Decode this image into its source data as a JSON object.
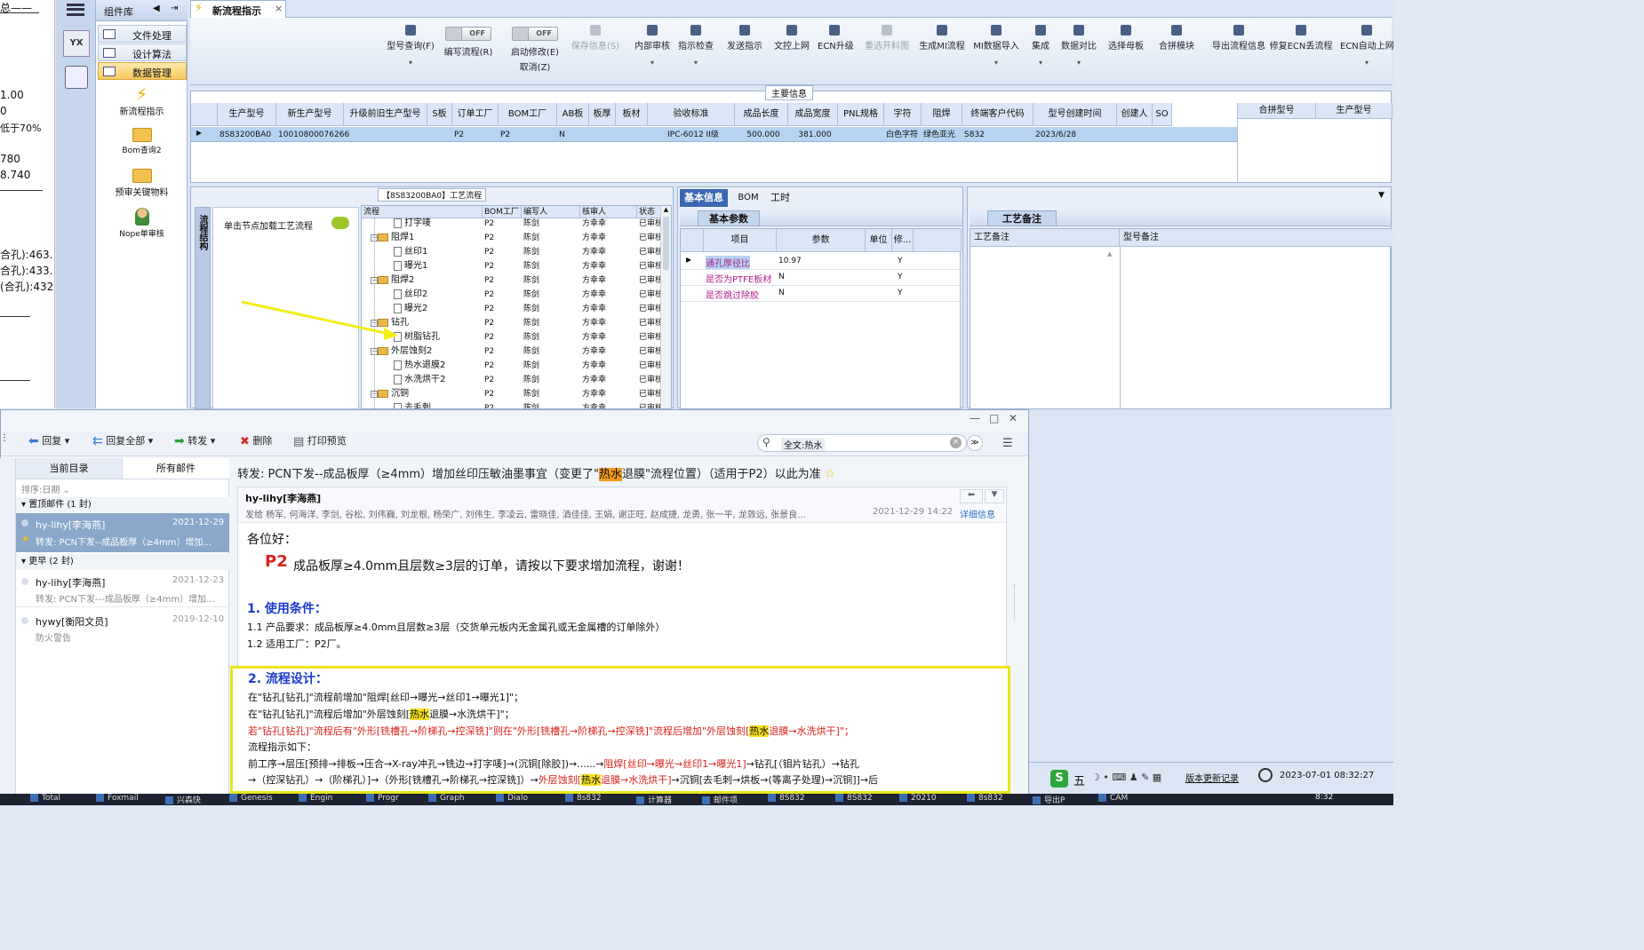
{
  "left_doc": {
    "lines": [
      "总——",
      "1.00",
      "0",
      "低于70%",
      "780",
      "8.740",
      "合孔):463.",
      "合孔):433.",
      "(合孔):432"
    ]
  },
  "nav": {
    "header": "组件库",
    "groups": [
      "文件处理",
      "设计算法",
      "数据管理"
    ],
    "tools": [
      {
        "label": "新流程指示",
        "icon": "lightning-icon"
      },
      {
        "label": "Bom查询2",
        "icon": "folder-icon"
      },
      {
        "label": "预审关键物料",
        "icon": "folder-icon"
      },
      {
        "label": "Nope单审核",
        "icon": "user-icon"
      }
    ]
  },
  "tab": {
    "title": "新流程指示",
    "close": "×"
  },
  "toolbar": {
    "buttons": [
      {
        "label": "型号查询(F)",
        "dd": "▾",
        "dis": false
      },
      {
        "label": "编写流程(R)",
        "toggle": "OFF",
        "dis": false
      },
      {
        "label": "启动修改(E)",
        "toggle": "OFF",
        "sub": "取消(Z)",
        "dis": false
      },
      {
        "label": "保存信息(S)",
        "dis": true
      },
      {
        "label": "内部审核",
        "dd": "▾",
        "dis": false
      },
      {
        "label": "指示检查",
        "dd": "▾",
        "dis": false
      },
      {
        "label": "发送指示",
        "dis": false
      },
      {
        "label": "文控上网",
        "dis": false
      },
      {
        "label": "ECN升级",
        "dis": false
      },
      {
        "label": "重选开料图",
        "dis": true
      },
      {
        "label": "生成MI流程",
        "dis": false
      },
      {
        "label": "MI数据导入",
        "dd": "▾",
        "dis": false
      },
      {
        "label": "集成",
        "dd": "▾",
        "dis": false
      },
      {
        "label": "数据对比",
        "dd": "▾",
        "dis": false
      },
      {
        "label": "选择母板",
        "dis": false
      },
      {
        "label": "合拼模块",
        "dis": false
      },
      {
        "label": "导出流程信息",
        "dis": false
      },
      {
        "label": "修复ECN丢流程",
        "dis": false
      },
      {
        "label": "ECN自动上网",
        "dd": "▾",
        "dis": false
      }
    ]
  },
  "main_info": {
    "title": "主要信息",
    "headers": [
      "生产型号",
      "新生产型号",
      "升级前旧生产型号",
      "S板",
      "订单工厂",
      "BOM工厂",
      "AB板",
      "板厚",
      "板材",
      "验收标准",
      "成品长度",
      "成品宽度",
      "PNL规格",
      "字符",
      "阻焊",
      "终端客户代码",
      "型号创建时间",
      "创建人",
      "SO"
    ],
    "row": [
      "8S83200BA0",
      "10010800076266",
      "",
      "",
      "P2",
      "P2",
      "N",
      "",
      "",
      "IPC-6012 II级",
      "500.000",
      "381.000",
      "",
      "白色字符",
      "绿色亚光",
      "S832",
      "2023/6/28",
      "",
      ""
    ],
    "side_headers": [
      "合拼型号",
      "生产型号"
    ]
  },
  "flow": {
    "title": "【8S83200BA0】工艺流程",
    "side_tab": "流程结构",
    "hint": "单击节点加载工艺流程",
    "headers": [
      "流程",
      "BOM工厂",
      "编写人",
      "核审人",
      "状态"
    ],
    "rows": [
      {
        "name": "打字唛",
        "lvl": 1,
        "type": "doc",
        "bom": "P2",
        "w": "陈剑",
        "r": "方幸幸",
        "s": "已审核"
      },
      {
        "name": "阻焊1",
        "lvl": 0,
        "type": "folder",
        "bom": "P2",
        "w": "陈剑",
        "r": "方幸幸",
        "s": "已审核"
      },
      {
        "name": "丝印1",
        "lvl": 1,
        "type": "doc",
        "bom": "P2",
        "w": "陈剑",
        "r": "方幸幸",
        "s": "已审核"
      },
      {
        "name": "曝光1",
        "lvl": 1,
        "type": "doc",
        "bom": "P2",
        "w": "陈剑",
        "r": "方幸幸",
        "s": "已审核"
      },
      {
        "name": "阻焊2",
        "lvl": 0,
        "type": "folder",
        "bom": "P2",
        "w": "陈剑",
        "r": "方幸幸",
        "s": "已审核"
      },
      {
        "name": "丝印2",
        "lvl": 1,
        "type": "doc",
        "bom": "P2",
        "w": "陈剑",
        "r": "方幸幸",
        "s": "已审核"
      },
      {
        "name": "曝光2",
        "lvl": 1,
        "type": "doc",
        "bom": "P2",
        "w": "陈剑",
        "r": "方幸幸",
        "s": "已审核"
      },
      {
        "name": "钻孔",
        "lvl": 0,
        "type": "folder",
        "bom": "P2",
        "w": "陈剑",
        "r": "方幸幸",
        "s": "已审核"
      },
      {
        "name": "树脂钻孔",
        "lvl": 1,
        "type": "doc",
        "bom": "P2",
        "w": "陈剑",
        "r": "方幸幸",
        "s": "已审核"
      },
      {
        "name": "外层蚀刻2",
        "lvl": 0,
        "type": "folder",
        "bom": "P2",
        "w": "陈剑",
        "r": "方幸幸",
        "s": "已审核"
      },
      {
        "name": "热水退膜2",
        "lvl": 1,
        "type": "doc",
        "bom": "P2",
        "w": "陈剑",
        "r": "方幸幸",
        "s": "已审核"
      },
      {
        "name": "水洗烘干2",
        "lvl": 1,
        "type": "doc",
        "bom": "P2",
        "w": "陈剑",
        "r": "方幸幸",
        "s": "已审核"
      },
      {
        "name": "沉铜",
        "lvl": 0,
        "type": "folder",
        "bom": "P2",
        "w": "陈剑",
        "r": "方幸幸",
        "s": "已审核"
      },
      {
        "name": "去毛刺",
        "lvl": 1,
        "type": "doc",
        "bom": "P2",
        "w": "陈剑",
        "r": "方幸幸",
        "s": "已审核"
      }
    ]
  },
  "basic": {
    "tabs": [
      "基本信息",
      "BOM",
      "工时"
    ],
    "section": "基本参数",
    "headers": [
      "项目",
      "参数",
      "单位",
      "修..."
    ],
    "rows": [
      {
        "item": "通孔厚径比",
        "val": "10.97",
        "unit": "",
        "mod": "Y"
      },
      {
        "item": "是否为PTFE板材",
        "val": "N",
        "unit": "",
        "mod": "Y"
      },
      {
        "item": "是否跳过除胶",
        "val": "N",
        "unit": "",
        "mod": "Y"
      }
    ]
  },
  "remarks": {
    "tab": "工艺备注",
    "col1": "工艺备注",
    "col2": "型号备注"
  },
  "mail": {
    "toolbar": [
      "回复",
      "回复全部",
      "转发",
      "删除",
      "打印预览"
    ],
    "search": "全文:热水",
    "folder_tabs": [
      "当前目录",
      "所有邮件"
    ],
    "sort": "排序:日期",
    "groups": [
      {
        "title": "置顶邮件 (1 封)",
        "items": [
          {
            "from": "hy-lihy[李海燕]",
            "date": "2021-12-29",
            "subject": "转发: PCN下发--成品板厚（≥4mm）增加...",
            "sel": true
          }
        ]
      },
      {
        "title": "更早 (2 封)",
        "items": [
          {
            "from": "hy-lihy[李海燕]",
            "date": "2021-12-23",
            "subject": "转发: PCN下发---成品板厚（≥4mm）增加...",
            "sel": false
          },
          {
            "from": "hywy[衡阳文员]",
            "date": "2019-12-10",
            "subject": "防火警告",
            "sel": false
          }
        ]
      }
    ],
    "subject_pre": "转发: PCN下发--成品板厚（≥4mm）增加丝印压敏油墨事宜（变更了\"",
    "subject_hl": "热水",
    "subject_post": "退膜\"流程位置）（适用于P2）以此为准",
    "sender": "hy-lihy[李海燕]",
    "recipients": "发给 杨军, 何海洋, 李剑, 谷松, 刘伟巍, 刘龙根, 杨荣广, 刘伟生, 李凌云, 雷晓佳, 酒佳佳, 王娟, 谢正旺, 赵成捷, 龙勇, 张一平, 龙敦远, 张景良...",
    "sent": "2021-12-29 14:22",
    "details": "详细信息",
    "greeting": "各位好：",
    "p2": "P2",
    "intro": "成品板厚≥4.0mm且层数≥3层的订单，请按以下要求增加流程，谢谢！",
    "s1": "1. 使用条件：",
    "s1a": "1.1  产品要求：成品板厚≥4.0mm且层数≥3层（交货单元板内无金属孔或无金属槽的订单除外）",
    "s1b": "1.2  适用工厂：P2厂。",
    "s2": "2. 流程设计：",
    "l1": "在\"钻孔[钻孔]\"流程前增加\"阻焊[丝印→曝光→丝印1→曝光1]\"；",
    "l2a": "在\"钻孔[钻孔]\"流程后增加\"外层蚀刻[",
    "l2hl": "热水",
    "l2b": "退膜→水洗烘干]\"；",
    "l3a": "若\"钻孔[钻孔]\"流程后有\"外形[铣槽孔→阶梯孔→控深铣]\"则在\"外形[铣槽孔→阶梯孔→控深铣]\"流程后增加\"外层蚀刻[",
    "l3hl": "热水",
    "l3b": "退膜→水洗烘干]\"；",
    "l4": "流程指示如下：",
    "l5a": "前工序→层压[预排→排板→压合→X-ray冲孔→铣边→打字唛]→(沉铜[除胶])→......→",
    "l5r": "阻焊[丝印→曝光→丝印1→曝光1]",
    "l5b": "→钻孔[（钼片钻孔）→钻孔",
    "l6a": "→（控深钻孔）→（阶梯孔）]→（外形[铣槽孔→阶梯孔→控深铣]）→",
    "l6r": "外层蚀刻[",
    "l6hl": "热水",
    "l6r2": "退膜→水洗烘干]",
    "l6b": "→沉铜[去毛刺→烘板→(等离子处理)→沉铜]]→后"
  },
  "status": {
    "ime": "五",
    "update": "版本更新记录",
    "datetime": "2023-07-01 08:32:27"
  },
  "taskbar": {
    "items": [
      "Total",
      "Foxmail",
      "兴森快",
      "Genesis",
      "Engin",
      "Progr",
      "Graph",
      "Dialo",
      "8s832",
      "计算器",
      "邮件项",
      "8S832",
      "8S832",
      "20210",
      "8s832",
      "导出P",
      "CAM"
    ],
    "time": "8:32"
  },
  "colors": {
    "accent": "#3b67b2",
    "highlight": "#f7e01b",
    "red": "#d9221b",
    "blue_heading": "#1a3ccc"
  }
}
